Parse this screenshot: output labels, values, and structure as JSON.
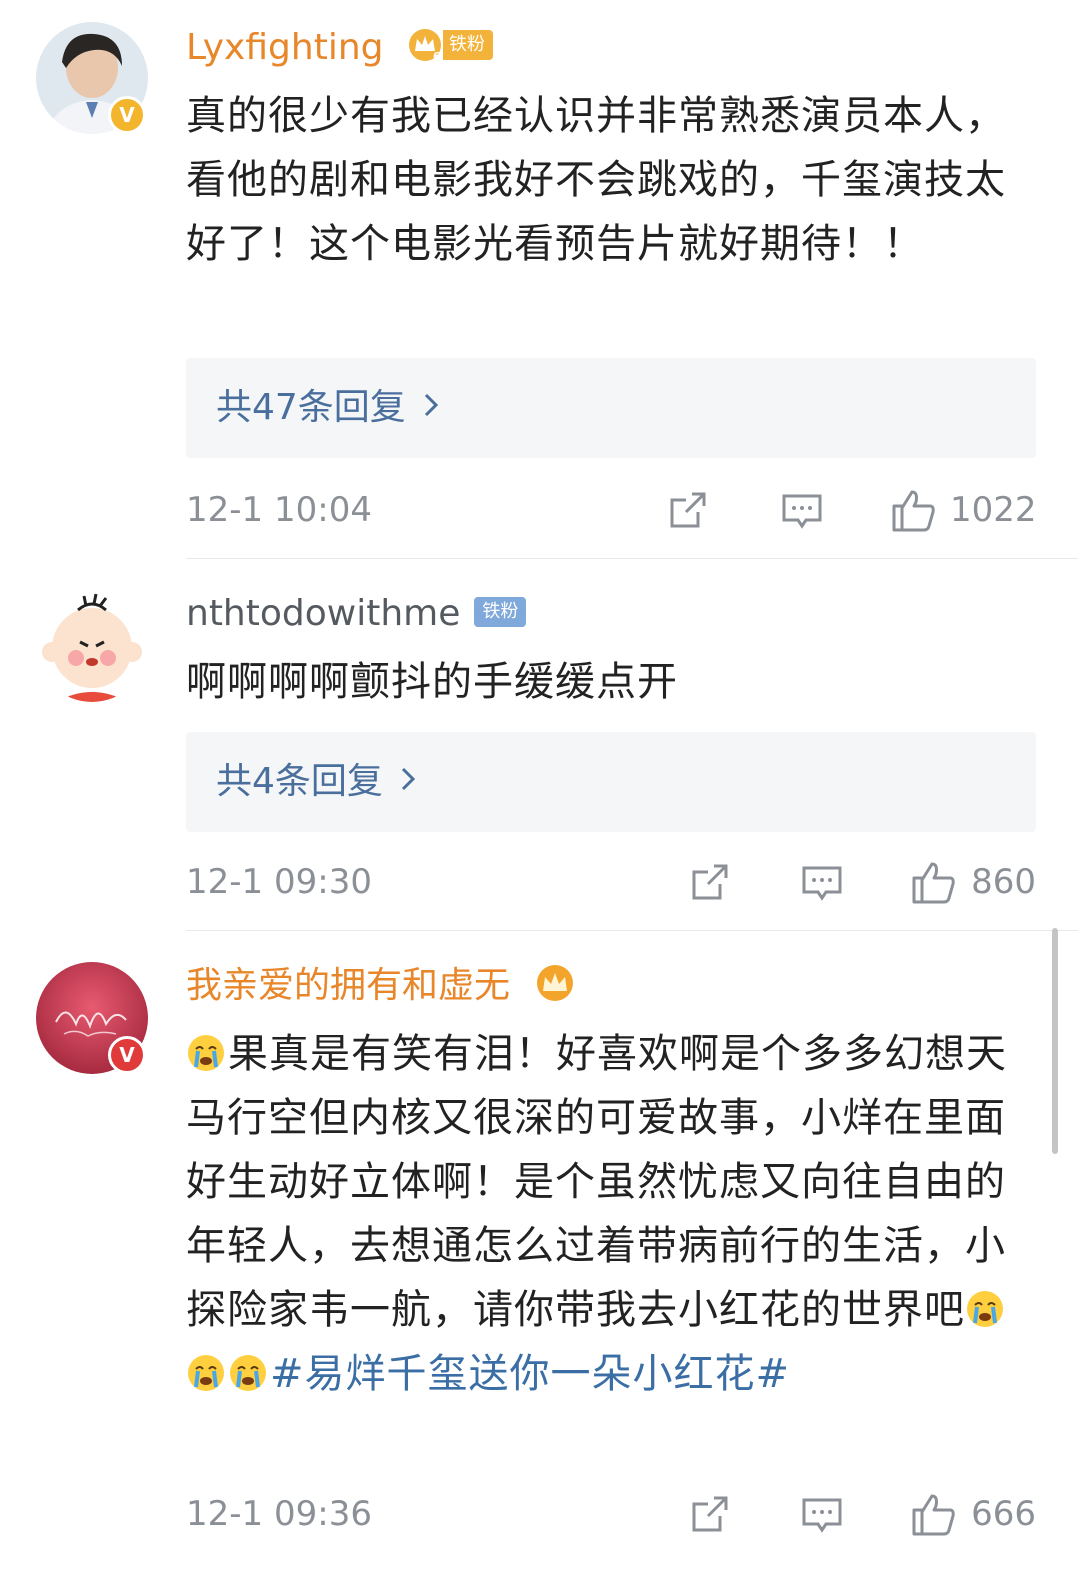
{
  "comments": [
    {
      "username": "Lyxfighting",
      "fan_badge": "铁粉",
      "text": "真的很少有我已经认识并非常熟悉演员本人，看他的剧和电影我好不会跳戏的，千玺演技太好了！这个电影光看预告片就好期待！！",
      "replies": "共47条回复",
      "time": "12-1 10:04",
      "likes": "1022"
    },
    {
      "username": "nthtodowithme",
      "fan_badge": "铁粉",
      "text": "啊啊啊啊颤抖的手缓缓点开",
      "replies": "共4条回复",
      "time": "12-1 09:30",
      "likes": "860"
    },
    {
      "username": "我亲爱的拥有和虚无",
      "text_main": "果真是有笑有泪！好喜欢啊是个多多幻想天马行空但内核又很深的可爱故事，小烊在里面好生动好立体啊！是个虽然忧虑又向往自由的年轻人，去想通怎么过着带病前行的生活，小探险家韦一航，请你带我去小红花的世界吧",
      "hashtag": "#易烊千玺送你一朵小红花#",
      "time": "12-1 09:36",
      "likes": "666"
    }
  ],
  "icons": {
    "share": "share-icon",
    "comment": "comment-icon",
    "like": "thumbs-up-icon",
    "verified": "verified-badge-icon",
    "crown": "crown-icon",
    "crying_emoji": "crying-emoji-icon"
  },
  "colors": {
    "username_vip": "#e8862a",
    "username_normal": "#555a60",
    "hashtag": "#3a6ea5",
    "reply_text": "#4a6f9c",
    "meta": "#8b8f96",
    "verified_gold": "#f3b52b",
    "verified_red": "#e03a3a"
  }
}
